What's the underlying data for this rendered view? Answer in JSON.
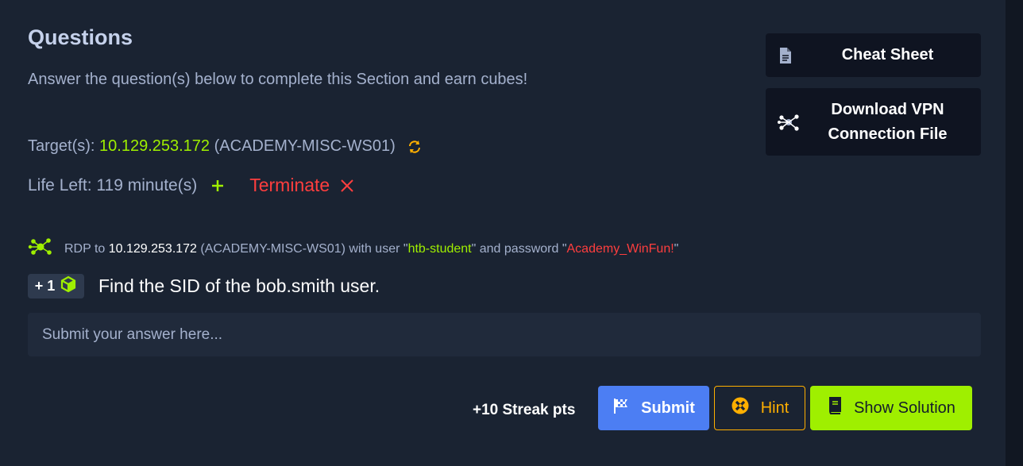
{
  "section": {
    "title": "Questions",
    "subtitle": "Answer the question(s) below to complete this Section and earn cubes!"
  },
  "target": {
    "label": "Target(s):",
    "ip": "10.129.253.172",
    "host": "(ACADEMY-MISC-WS01)"
  },
  "life": {
    "label": "Life Left: 119 minute(s)",
    "terminate_label": "Terminate"
  },
  "sidebar": {
    "cheat_sheet_label": "Cheat Sheet",
    "vpn_line1": "Download VPN",
    "vpn_line2": "Connection File"
  },
  "rdp": {
    "prefix": "RDP to",
    "ip": "10.129.253.172",
    "host": "(ACADEMY-MISC-WS01)",
    "with_user": "with user \"",
    "user": "htb-student",
    "and_password": "\" and password \"",
    "password": "Academy_WinFun!",
    "close_quote": "\""
  },
  "question": {
    "badge": "+ 1",
    "text": "Find the SID of the bob.smith user."
  },
  "answer": {
    "placeholder": "Submit your answer here..."
  },
  "actions": {
    "streak": "+10 Streak pts",
    "submit_label": "Submit",
    "hint_label": "Hint",
    "solution_label": "Show Solution"
  },
  "icons": {
    "refresh": "refresh-icon",
    "plus": "plus-icon",
    "close": "close-icon",
    "document": "document-icon",
    "network": "network-icon",
    "cube": "cube-icon",
    "flag": "flag-icon",
    "hint": "hint-icon",
    "book": "book-icon"
  },
  "colors": {
    "accent_green": "#9fef00",
    "danger_red": "#ff3e3e",
    "hint_orange": "#ffaf00",
    "submit_blue": "#4c7ef3",
    "panel_bg": "#1a2332"
  }
}
